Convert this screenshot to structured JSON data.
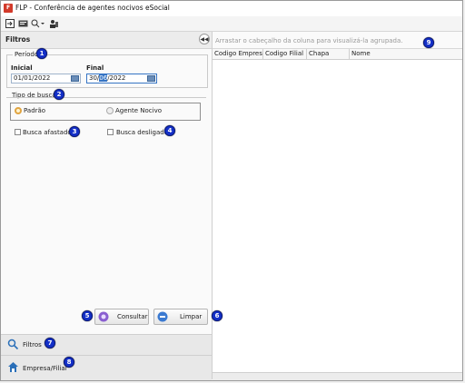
{
  "window": {
    "title": "FLP - Conferência de agentes nocivos eSocial",
    "app_icon": "flp-app-icon"
  },
  "toolbar": {
    "icons": [
      "exit-icon",
      "report-icon",
      "zoom-icon",
      "users-icon"
    ]
  },
  "filters_panel": {
    "title": "Filtros",
    "periodo": {
      "legend": "Período",
      "inicial_label": "Inicial",
      "inicial_value": "01/01/2022",
      "final_label": "Final",
      "final_value_pre": "30/",
      "final_value_sel": "06",
      "final_value_post": "/2022"
    },
    "tipo_busca": {
      "legend": "Tipo de busca",
      "option_padrao": "Padrão",
      "option_agente": "Agente Nocivo",
      "selected": "Padrão"
    },
    "busca_afastados": "Busca afastados",
    "busca_desligados": "Busca desligados",
    "consultar_label": "Consultar",
    "limpar_label": "Limpar"
  },
  "nav": {
    "filtros": "Filtros",
    "empresa_filial": "Empresa/Filial"
  },
  "grid": {
    "group_hint": "Arrastar o cabeçalho da coluna para visualizá-la agrupada.",
    "columns": [
      "Codigo Empresa",
      "Codigo Filial",
      "Chapa",
      "Nome"
    ]
  },
  "badges": [
    "1",
    "2",
    "3",
    "4",
    "5",
    "6",
    "7",
    "8",
    "9"
  ],
  "colors": {
    "badge": "#1430c8",
    "radio_selected": "#e0a441",
    "selection": "#3574c4"
  }
}
